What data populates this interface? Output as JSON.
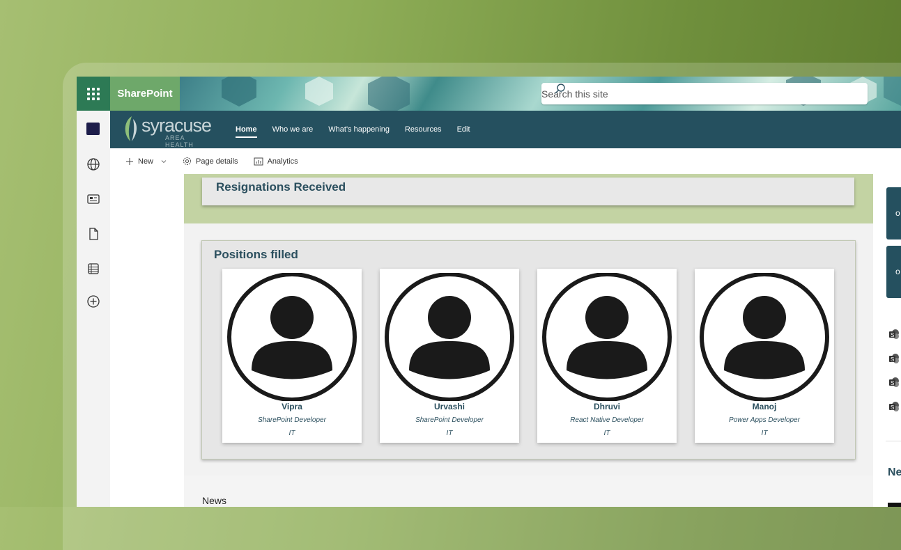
{
  "suitebar": {
    "app_name": "SharePoint",
    "search_placeholder": "Search this site"
  },
  "site": {
    "logo_text": "syracuse",
    "logo_subtext": "AREA HEALTH",
    "nav": [
      {
        "label": "Home",
        "active": true
      },
      {
        "label": "Who we are"
      },
      {
        "label": "What's happening"
      },
      {
        "label": "Resources"
      },
      {
        "label": "Edit"
      }
    ]
  },
  "commandbar": {
    "new_label": "New",
    "page_details_label": "Page details",
    "analytics_label": "Analytics"
  },
  "sections": {
    "resignations_title": "Resignations Received",
    "positions_title": "Positions filled",
    "news_title": "News"
  },
  "people": [
    {
      "name": "Vipra",
      "role": "SharePoint Developer",
      "dept": "IT"
    },
    {
      "name": "Urvashi",
      "role": "SharePoint Developer",
      "dept": "IT"
    },
    {
      "name": "Dhruvi",
      "role": "React Native Developer",
      "dept": "IT"
    },
    {
      "name": "Manoj",
      "role": "Power Apps Developer",
      "dept": "IT"
    }
  ],
  "right_column": {
    "tile_1_text": "o",
    "tile_2_text": "o",
    "news_partial": "Ne"
  },
  "colors": {
    "header_bg": "#25505f",
    "brand_green": "#6ea86a",
    "heading_text": "#2b4f5e"
  }
}
